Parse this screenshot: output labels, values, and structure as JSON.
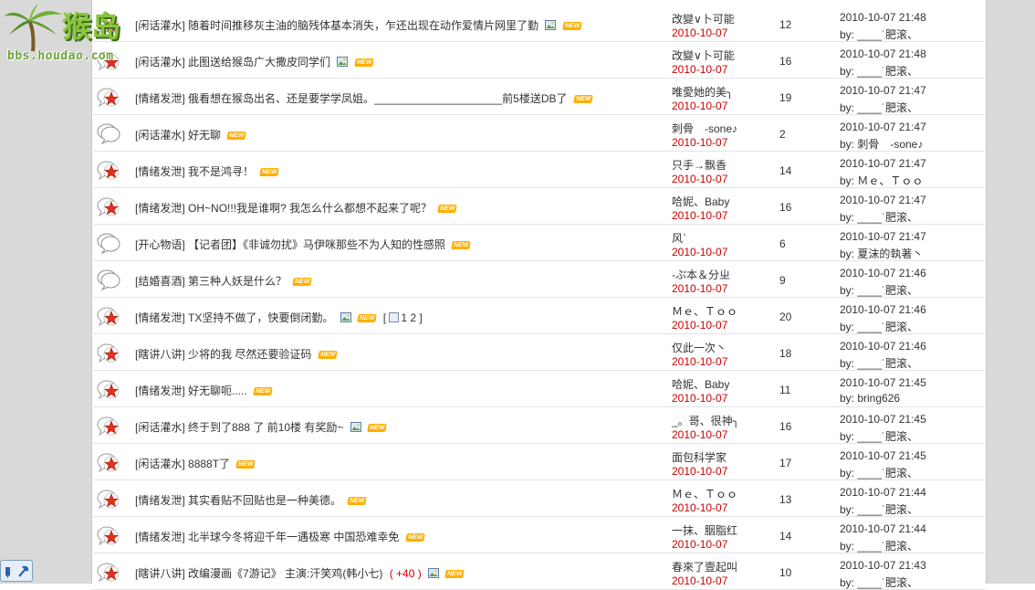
{
  "logo": {
    "name": "猴岛",
    "url": "bbs.houdao.com"
  },
  "colors": {
    "new_badge": "#ffae00",
    "date": "#cc0000",
    "star": "#e0301e"
  },
  "threads": [
    {
      "icon": "hot",
      "cat": "[闲话灌水]",
      "title": "随着时间推移灰主油的脑残体基本消失，乍还出现在动作爱情片网里了勤",
      "img": true,
      "pages": "",
      "extra": "",
      "author": "改變∨卜可能",
      "date": "2010-10-07",
      "replies": "12",
      "last_time": "2010-10-07 21:48",
      "last_by": "by: ____˙肥滚、"
    },
    {
      "icon": "hot",
      "cat": "[闲话灌水]",
      "title": "此图送给猴岛广大撒皮同学们",
      "img": true,
      "pages": "",
      "extra": "",
      "author": "改變∨卜可能",
      "date": "2010-10-07",
      "replies": "16",
      "last_time": "2010-10-07 21:48",
      "last_by": "by: ____˙肥滚、"
    },
    {
      "icon": "hot",
      "cat": "[情绪发泄]",
      "title": "俄看想在猴岛出名、还是要学学凤姐。_____________________前5楼送DB了",
      "img": false,
      "pages": "",
      "extra": "",
      "author": "唯愛她的美╮",
      "date": "2010-10-07",
      "replies": "19",
      "last_time": "2010-10-07 21:47",
      "last_by": "by: ____˙肥滚、"
    },
    {
      "icon": "normal",
      "cat": "[闲话灌水]",
      "title": "好无聊",
      "img": false,
      "pages": "",
      "extra": "",
      "author": "刺骨　-sone♪",
      "date": "2010-10-07",
      "replies": "2",
      "last_time": "2010-10-07 21:47",
      "last_by": "by: 刺骨　-sone♪"
    },
    {
      "icon": "hot",
      "cat": "[情绪发泄]",
      "title": "我不是鸿寻！",
      "img": false,
      "pages": "",
      "extra": "",
      "author": "只手→飘香",
      "date": "2010-10-07",
      "replies": "14",
      "last_time": "2010-10-07 21:47",
      "last_by": "by: Ｍｅ、Ｔｏｏ"
    },
    {
      "icon": "hot",
      "cat": "[情绪发泄]",
      "title": "OH~NO!!!我是谁啊? 我怎么什么都想不起来了呢？",
      "img": false,
      "pages": "",
      "extra": "",
      "author": "哈妮、Baby",
      "date": "2010-10-07",
      "replies": "16",
      "last_time": "2010-10-07 21:47",
      "last_by": "by: ____˙肥滚、"
    },
    {
      "icon": "normal",
      "cat": "[开心物语]",
      "title": "【记者团】《非诚勿扰》马伊咪那些不为人知的性感照",
      "img": false,
      "pages": "",
      "extra": "",
      "author": "风ˋ",
      "date": "2010-10-07",
      "replies": "6",
      "last_time": "2010-10-07 21:47",
      "last_by": "by: 夏沫的執著丶"
    },
    {
      "icon": "normal",
      "cat": "[结婚喜酒]",
      "title": "第三种人妖是什么？",
      "img": false,
      "pages": "",
      "extra": "",
      "author": "-ぷ本＆分ㄓ",
      "date": "2010-10-07",
      "replies": "9",
      "last_time": "2010-10-07 21:46",
      "last_by": "by: ____˙肥滚、"
    },
    {
      "icon": "hot",
      "cat": "[情绪发泄]",
      "title": "TX坚持不做了，快要倒闭勤。",
      "img": true,
      "pages": "1 2",
      "extra": "",
      "author": "Ｍｅ、Ｔｏｏ",
      "date": "2010-10-07",
      "replies": "20",
      "last_time": "2010-10-07 21:46",
      "last_by": "by: ____˙肥滚、"
    },
    {
      "icon": "hot",
      "cat": "[瞎讲八讲]",
      "title": "少将的我 尽然还要验证码",
      "img": false,
      "pages": "",
      "extra": "",
      "author": "仅此一次丶",
      "date": "2010-10-07",
      "replies": "18",
      "last_time": "2010-10-07 21:46",
      "last_by": "by: ____˙肥滚、"
    },
    {
      "icon": "hot",
      "cat": "[情绪发泄]",
      "title": "好无聊呃.....",
      "img": false,
      "pages": "",
      "extra": "",
      "author": "哈妮、Baby",
      "date": "2010-10-07",
      "replies": "11",
      "last_time": "2010-10-07 21:45",
      "last_by": "by: bring626"
    },
    {
      "icon": "hot",
      "cat": "[闲话灌水]",
      "title": "终于到了888 了 前10楼 有奖励~",
      "img": true,
      "pages": "",
      "extra": "",
      "author": "_。哥、很神╮",
      "date": "2010-10-07",
      "replies": "16",
      "last_time": "2010-10-07 21:45",
      "last_by": "by: ____˙肥滚、"
    },
    {
      "icon": "hot",
      "cat": "[闲话灌水]",
      "title": "8888T了",
      "img": false,
      "pages": "",
      "extra": "",
      "author": "面包科学家",
      "date": "2010-10-07",
      "replies": "17",
      "last_time": "2010-10-07 21:45",
      "last_by": "by: ____˙肥滚、"
    },
    {
      "icon": "hot",
      "cat": "[情绪发泄]",
      "title": "其实看贴不回贴也是一种美德。",
      "img": false,
      "pages": "",
      "extra": "",
      "author": "Ｍｅ、Ｔｏｏ",
      "date": "2010-10-07",
      "replies": "13",
      "last_time": "2010-10-07 21:44",
      "last_by": "by: ____˙肥滚、"
    },
    {
      "icon": "hot",
      "cat": "[情绪发泄]",
      "title": "北半球今冬将迎千年一遇极寒 中国恐难幸免",
      "img": false,
      "pages": "",
      "extra": "",
      "author": "一抹、胭脂红",
      "date": "2010-10-07",
      "replies": "14",
      "last_time": "2010-10-07 21:44",
      "last_by": "by: ____˙肥滚、"
    },
    {
      "icon": "hot",
      "cat": "[瞎讲八讲]",
      "title": "改编漫画《7游记》 主演:汗笑鸡(韩小七)",
      "img": true,
      "pages": "",
      "extra": "( +40 )",
      "author": "春來了壹起叫",
      "date": "2010-10-07",
      "replies": "10",
      "last_time": "2010-10-07 21:43",
      "last_by": "by: ____˙肥滚、"
    }
  ]
}
